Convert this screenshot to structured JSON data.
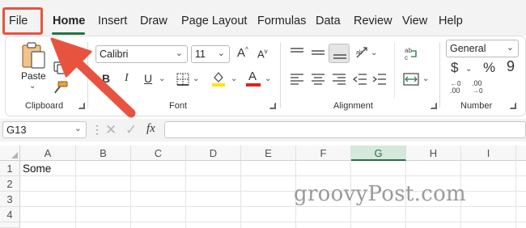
{
  "ribbon_tabs": {
    "file": "File",
    "home": "Home",
    "insert": "Insert",
    "draw": "Draw",
    "page_layout": "Page Layout",
    "formulas": "Formulas",
    "data": "Data",
    "review": "Review",
    "view": "View",
    "help": "Help"
  },
  "clipboard": {
    "paste_label": "Paste",
    "group_label": "Clipboard"
  },
  "font": {
    "font_name": "Calibri",
    "font_size": "11",
    "bold": "B",
    "italic": "I",
    "underline": "U",
    "grow": "A",
    "shrink": "A",
    "font_color_letter": "A",
    "group_label": "Font"
  },
  "alignment": {
    "group_label": "Alignment"
  },
  "number": {
    "format_value": "General",
    "currency_symbol": "$",
    "percent_symbol": "%",
    "comma_symbol": "9",
    "increase_decimal": ".00",
    "decrease_decimal": ".00",
    "group_label": "Number"
  },
  "formula_bar": {
    "name_box": "G13",
    "fx_label": "fx",
    "formula_value": ""
  },
  "columns": [
    "A",
    "B",
    "C",
    "D",
    "E",
    "F",
    "G",
    "H",
    "I"
  ],
  "rows": [
    "1",
    "2",
    "3",
    "4"
  ],
  "cells": {
    "A1": "Some"
  },
  "watermark": "groovyPost.com",
  "colors": {
    "accent": "#217346",
    "highlight_annotation": "#e8533f",
    "font_color_bar": "#e02020",
    "highlight_bar": "#ffe500"
  }
}
